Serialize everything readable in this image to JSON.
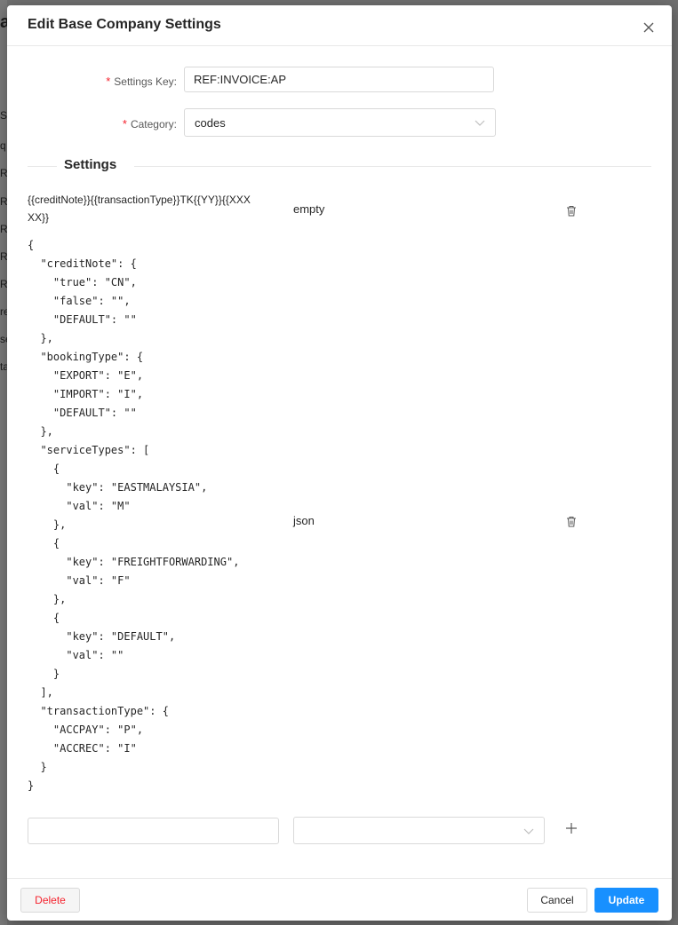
{
  "background": {
    "partial_text": [
      "a",
      "S",
      "q",
      "R",
      "R",
      "R",
      "R",
      "R",
      "re",
      "se",
      "ta"
    ]
  },
  "modal": {
    "title": "Edit Base Company Settings",
    "close_icon": "close-icon"
  },
  "form": {
    "settings_key_label": "Settings Key",
    "settings_key_value": "REF:INVOICE:AP",
    "category_label": "Category",
    "category_value": "codes",
    "required_mark": "*",
    "label_colon": ":"
  },
  "settings_section": {
    "title": "Settings",
    "rows": [
      {
        "key": "{{creditNote}}{{transactionType}}TK{{YY}}{{XXXXX}}",
        "type": "empty"
      },
      {
        "key": "{\n  \"creditNote\": {\n    \"true\": \"CN\",\n    \"false\": \"\",\n    \"DEFAULT\": \"\"\n  },\n  \"bookingType\": {\n    \"EXPORT\": \"E\",\n    \"IMPORT\": \"I\",\n    \"DEFAULT\": \"\"\n  },\n  \"serviceTypes\": [\n    {\n      \"key\": \"EASTMALAYSIA\",\n      \"val\": \"M\"\n    },\n    {\n      \"key\": \"FREIGHTFORWARDING\",\n      \"val\": \"F\"\n    },\n    {\n      \"key\": \"DEFAULT\",\n      \"val\": \"\"\n    }\n  ],\n  \"transactionType\": {\n    \"ACCPAY\": \"P\",\n    \"ACCREC\": \"I\"\n  }\n}",
        "type": "json"
      }
    ],
    "new_row": {
      "key_value": "",
      "type_value": ""
    }
  },
  "footer": {
    "delete_label": "Delete",
    "cancel_label": "Cancel",
    "update_label": "Update"
  },
  "colors": {
    "primary": "#1890ff",
    "danger": "#f5222d",
    "overlay": "#6f6f6f"
  }
}
